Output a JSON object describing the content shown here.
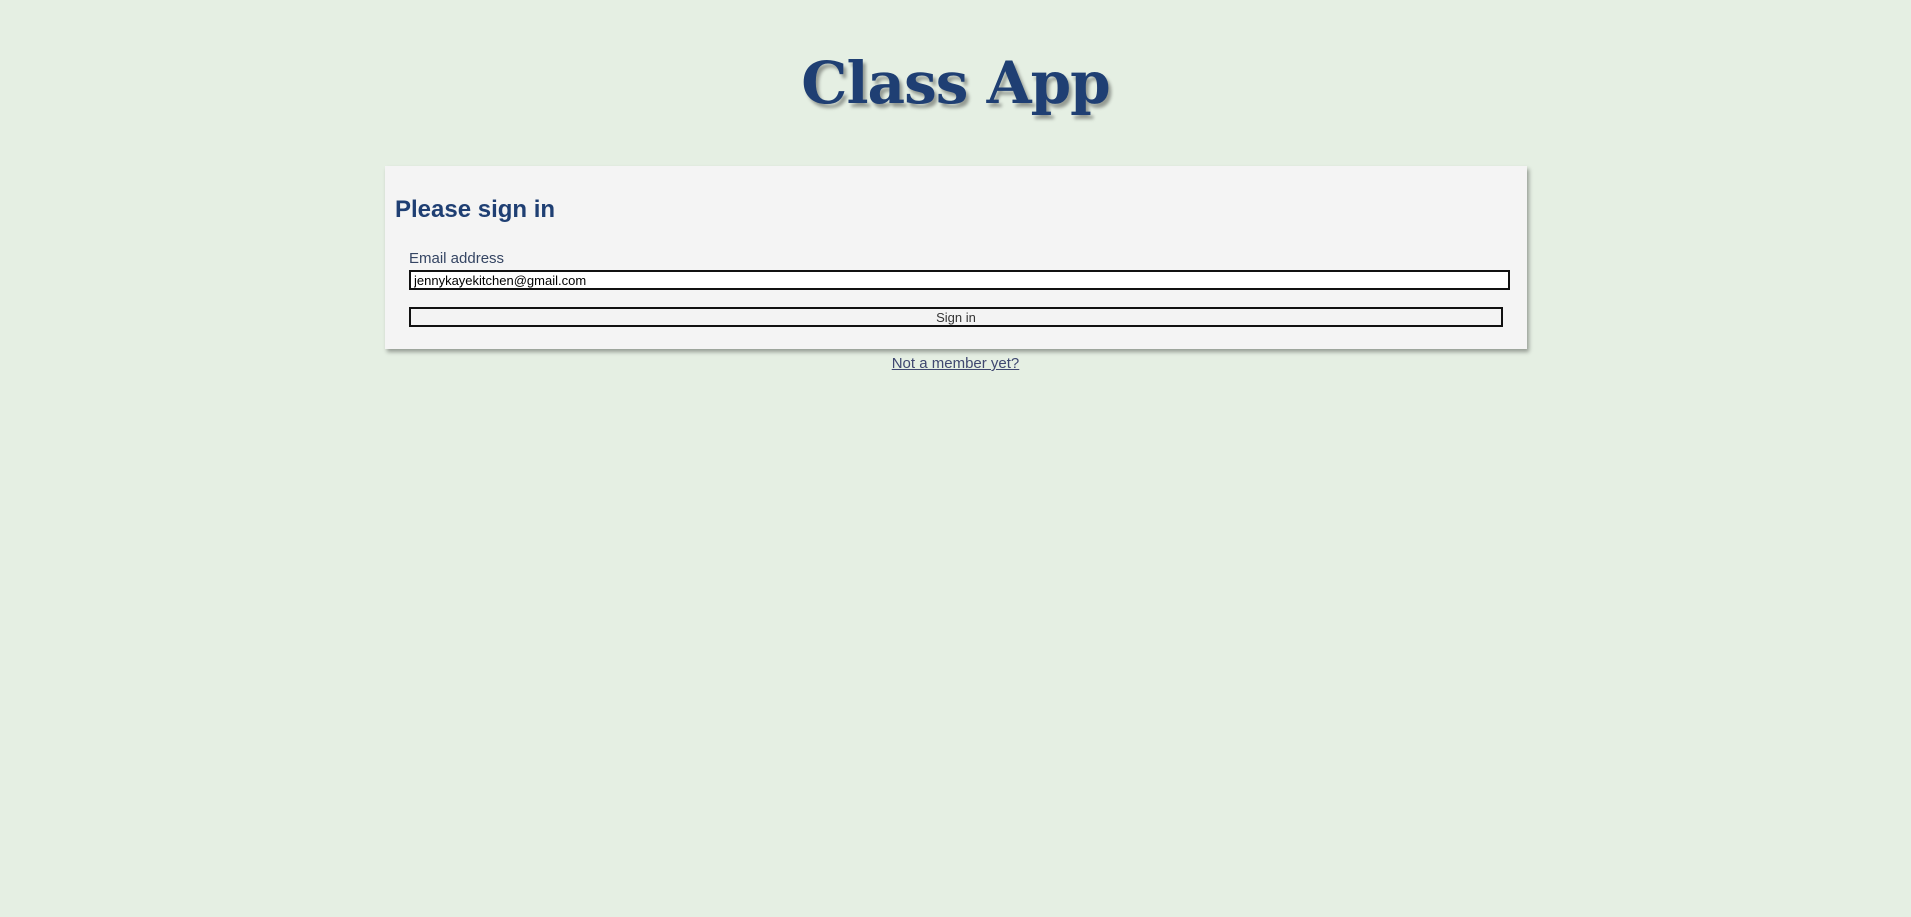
{
  "app": {
    "logo_text": "Class App"
  },
  "signin": {
    "title": "Please sign in",
    "email_label": "Email address",
    "email_value": "jennykayekitchen@gmail.com",
    "submit_label": "Sign in"
  },
  "footer": {
    "register_link": "Not a member yet?"
  },
  "colors": {
    "background": "#e5efe3",
    "brand": "#1f3f73",
    "card": "#f4f4f4"
  }
}
